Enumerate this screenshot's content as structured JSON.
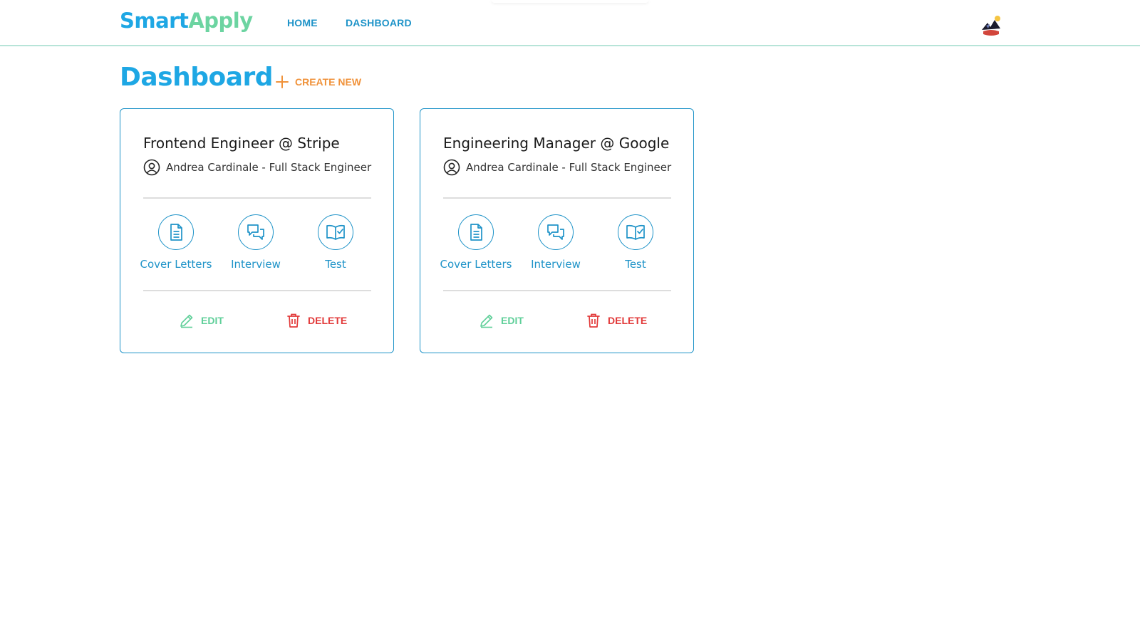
{
  "header": {
    "logo_part1": "Smart",
    "logo_part2": "Apply",
    "nav": [
      "HOME",
      "DASHBOARD"
    ]
  },
  "main": {
    "title": "Dashboard",
    "create_label": "CREATE NEW"
  },
  "cards": [
    {
      "title": "Frontend Engineer @ Stripe",
      "user": "Andrea Cardinale - Full Stack Engineer",
      "actions": [
        "Cover Letters",
        "Interview",
        "Test"
      ],
      "edit_label": "EDIT",
      "delete_label": "DELETE"
    },
    {
      "title": "Engineering Manager @ Google",
      "user": "Andrea Cardinale - Full Stack Engineer",
      "actions": [
        "Cover Letters",
        "Interview",
        "Test"
      ],
      "edit_label": "EDIT",
      "delete_label": "DELETE"
    }
  ],
  "icons": {
    "create": "plus-icon",
    "user": "user-circle-icon",
    "cover_letters": "document-icon",
    "interview": "chat-bubbles-icon",
    "test": "book-check-icon",
    "edit": "pencil-icon",
    "delete": "trash-icon",
    "avatar": "avatar-image"
  },
  "colors": {
    "primary_blue": "#1ea7e4",
    "link_blue": "#1e93c8",
    "green": "#6cd4a1",
    "orange": "#f0923a",
    "red": "#e23a3a",
    "divider": "#b7e4d8"
  }
}
